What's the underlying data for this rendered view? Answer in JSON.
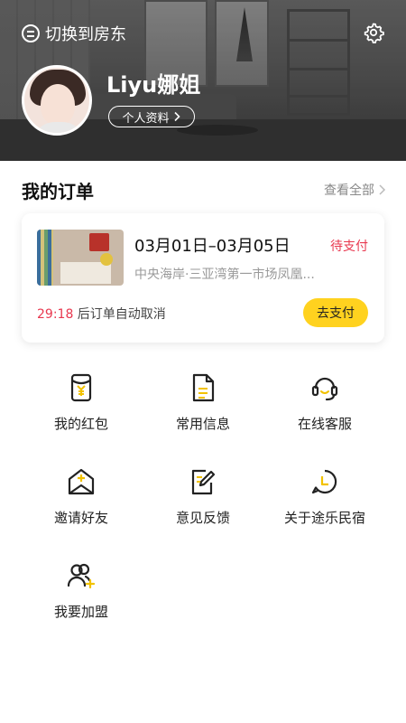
{
  "header": {
    "switch_label": "切换到房东",
    "user_name": "Liyu娜姐",
    "profile_label": "个人资料"
  },
  "orders": {
    "title": "我的订单",
    "view_all": "查看全部",
    "order": {
      "dates": "03月01日–03月05日",
      "status": "待支付",
      "address": "中央海岸·三亚湾第一市场凤凰...",
      "countdown": "29:18",
      "countdown_suffix": " 后订单自动取消",
      "pay_label": "去支付"
    }
  },
  "menu": [
    {
      "label": "我的红包",
      "icon": "red-packet-icon"
    },
    {
      "label": "常用信息",
      "icon": "document-icon"
    },
    {
      "label": "在线客服",
      "icon": "headset-icon"
    },
    {
      "label": "邀请好友",
      "icon": "invite-envelope-icon"
    },
    {
      "label": "意见反馈",
      "icon": "feedback-edit-icon"
    },
    {
      "label": "关于途乐民宿",
      "icon": "about-clock-chat-icon"
    },
    {
      "label": "我要加盟",
      "icon": "join-user-add-icon"
    }
  ],
  "colors": {
    "accent": "#ffd21f",
    "alert": "#e8384f"
  }
}
